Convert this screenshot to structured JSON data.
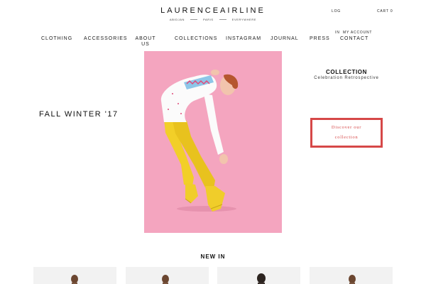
{
  "brand": {
    "logo": "LAURENCEAIRLINE",
    "cities": [
      "ABIDJAN",
      "PARIS",
      "EVERYWHERE"
    ]
  },
  "top_links": {
    "login": "LOG",
    "cart": "CART 0",
    "language": "IN",
    "account": "MY ACCOUNT"
  },
  "nav": {
    "clothing": "CLOTHING",
    "accessories": "ACCESSORIES",
    "about_line1": "ABOUT",
    "about_line2": "US",
    "collections": "COLLECTIONS",
    "instagram": "INSTAGRAM",
    "journal": "JOURNAL",
    "press": "PRESS",
    "contact": "CONTACT"
  },
  "hero": {
    "season": "FALL WINTER '17",
    "background_color": "#f4a5bf"
  },
  "collection": {
    "title": "COLLECTION",
    "subtitle": "Celebration Retrospective",
    "cta": "Discover our collection",
    "cta_color": "#d64848"
  },
  "new_in": {
    "title": "NEW IN"
  },
  "icons": [
    "model-photo",
    "product-thumbnail"
  ]
}
